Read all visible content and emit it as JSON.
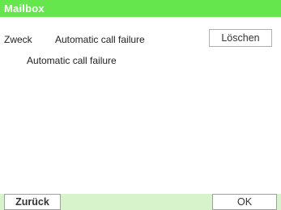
{
  "header": {
    "title": "Mailbox"
  },
  "message": {
    "field_label": "Zweck",
    "field_value": "Automatic call failure",
    "body_text": "Automatic call failure"
  },
  "actions": {
    "delete_label": "Löschen",
    "back_label": "Zurück",
    "ok_label": "OK"
  },
  "colors": {
    "titlebar": "#66e64d",
    "footer": "#d6f3cc"
  }
}
